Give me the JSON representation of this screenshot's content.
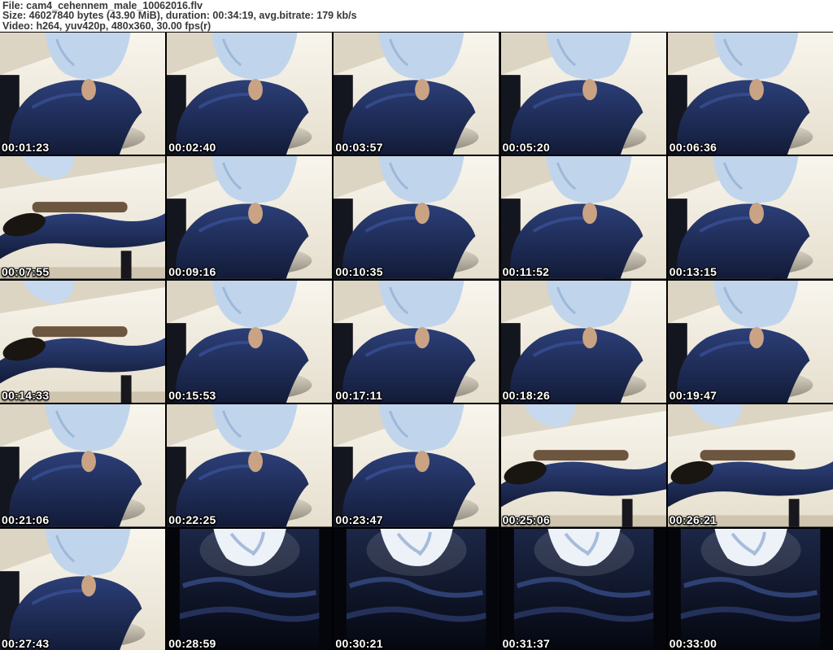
{
  "header": {
    "file_line": "File: cam4_cehennem_male_10062016.flv",
    "size_line": "Size: 46027840 bytes (43.90 MiB), duration: 00:34:19, avg.bitrate: 179 kb/s",
    "video_line": "Video: h264, yuv420p, 480x360, 30.00 fps(r)"
  },
  "colors": {
    "header_text": "#383838",
    "grid_background": "#000000",
    "wall": "#f2ecdf",
    "jeans": "#1d2c55",
    "shirt": "#c0d5ec",
    "chair_seat": "#d8d1c2",
    "shadow": "#14161f",
    "timestamp_text": "#ffffff",
    "timestamp_outline": "#000000"
  },
  "grid": {
    "columns": 5,
    "rows": 5,
    "thumbnails": [
      {
        "timestamp": "00:01:23",
        "variant": "a"
      },
      {
        "timestamp": "00:02:40",
        "variant": "a"
      },
      {
        "timestamp": "00:03:57",
        "variant": "a"
      },
      {
        "timestamp": "00:05:20",
        "variant": "a"
      },
      {
        "timestamp": "00:06:36",
        "variant": "a"
      },
      {
        "timestamp": "00:07:55",
        "variant": "c"
      },
      {
        "timestamp": "00:09:16",
        "variant": "a"
      },
      {
        "timestamp": "00:10:35",
        "variant": "a"
      },
      {
        "timestamp": "00:11:52",
        "variant": "a"
      },
      {
        "timestamp": "00:13:15",
        "variant": "a"
      },
      {
        "timestamp": "00:14:33",
        "variant": "c"
      },
      {
        "timestamp": "00:15:53",
        "variant": "a"
      },
      {
        "timestamp": "00:17:11",
        "variant": "a"
      },
      {
        "timestamp": "00:18:26",
        "variant": "a"
      },
      {
        "timestamp": "00:19:47",
        "variant": "a"
      },
      {
        "timestamp": "00:21:06",
        "variant": "a"
      },
      {
        "timestamp": "00:22:25",
        "variant": "a"
      },
      {
        "timestamp": "00:23:47",
        "variant": "a"
      },
      {
        "timestamp": "00:25:06",
        "variant": "c"
      },
      {
        "timestamp": "00:26:21",
        "variant": "c"
      },
      {
        "timestamp": "00:27:43",
        "variant": "a"
      },
      {
        "timestamp": "00:28:59",
        "variant": "b"
      },
      {
        "timestamp": "00:30:21",
        "variant": "b"
      },
      {
        "timestamp": "00:31:37",
        "variant": "b"
      },
      {
        "timestamp": "00:33:00",
        "variant": "b"
      }
    ]
  }
}
